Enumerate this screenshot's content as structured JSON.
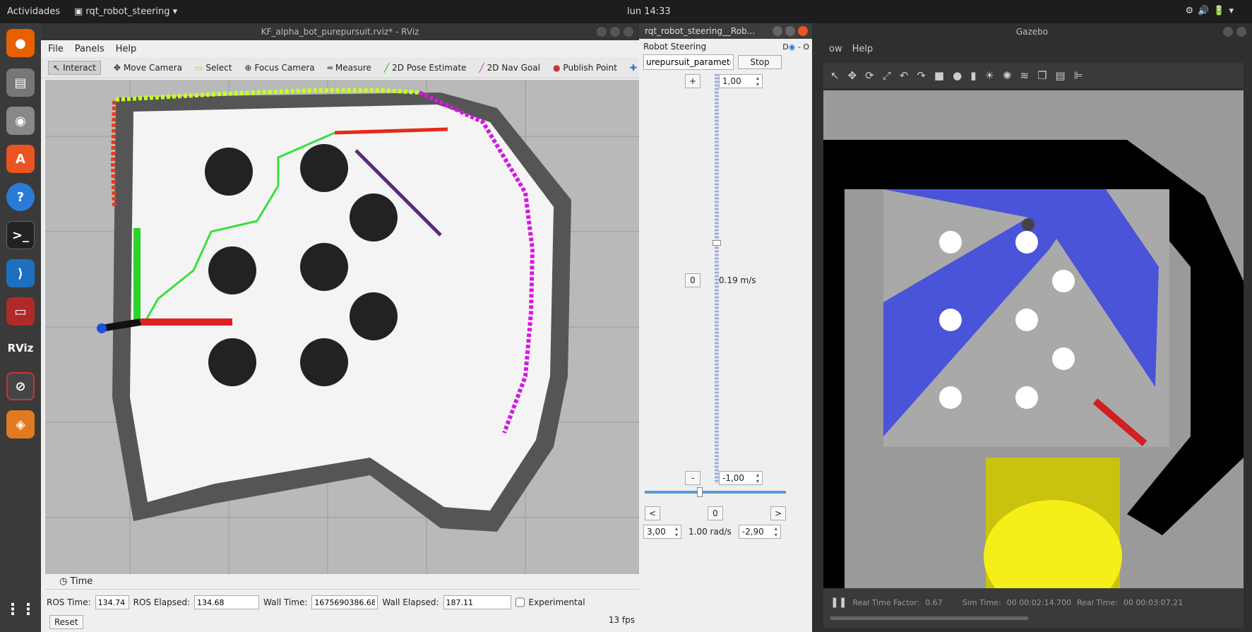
{
  "topbar": {
    "activities": "Actividades",
    "app_name": "rqt_robot_steering",
    "clock": "lun 14:33"
  },
  "dock": {
    "items": [
      "firefox-icon",
      "files-icon",
      "rhythmbox-icon",
      "software-icon",
      "help-icon",
      "terminal-icon",
      "vscode-icon",
      "display-icon",
      "rviz-icon",
      "rqt-icon",
      "stack-icon"
    ],
    "rviz_label": "RViz"
  },
  "rviz": {
    "title": "KF_alpha_bot_purepursuit.rviz* - RViz",
    "menu": {
      "file": "File",
      "panels": "Panels",
      "help": "Help"
    },
    "tools": {
      "interact": "Interact",
      "move_camera": "Move Camera",
      "select": "Select",
      "focus_camera": "Focus Camera",
      "measure": "Measure",
      "pose_estimate": "2D Pose Estimate",
      "nav_goal": "2D Nav Goal",
      "publish_point": "Publish Point"
    },
    "time_panel": {
      "header": "Time",
      "ros_time_label": "ROS Time:",
      "ros_time": "134.74",
      "ros_elapsed_label": "ROS Elapsed:",
      "ros_elapsed": "134.68",
      "wall_time_label": "Wall Time:",
      "wall_time": "1675690386.68",
      "wall_elapsed_label": "Wall Elapsed:",
      "wall_elapsed": "187.11",
      "experimental": "Experimental",
      "reset": "Reset",
      "fps": "13 fps"
    }
  },
  "rqt": {
    "title": "rqt_robot_steering__Rob...",
    "plugin_title": "Robot Steering",
    "topic": "urepursuit_parameters",
    "stop": "Stop",
    "plus": "+",
    "minus": "-",
    "zero": "0",
    "max_lin": "1,00",
    "min_lin": "-1,00",
    "linear_readout": "0.19 m/s",
    "lin_level": 0.595,
    "left": "<",
    "right": ">",
    "max_ang": "3,00",
    "min_ang": "-2,90",
    "angular_readout": "1.00 rad/s",
    "ang_level": 0.37
  },
  "gazebo": {
    "title": "Gazebo",
    "menu_partial": "ow",
    "help": "Help",
    "status": {
      "rtf_label": "Real Time Factor:",
      "rtf": "0.67",
      "sim_label": "Sim Time:",
      "sim": "00 00:02:14.700",
      "real_label": "Real Time:",
      "real": "00 00:03:07.21"
    }
  },
  "colors": {
    "accent": "#e95420",
    "laser": "#3a45e0",
    "path": "#39e03b",
    "yellow": "#f5ee19"
  }
}
